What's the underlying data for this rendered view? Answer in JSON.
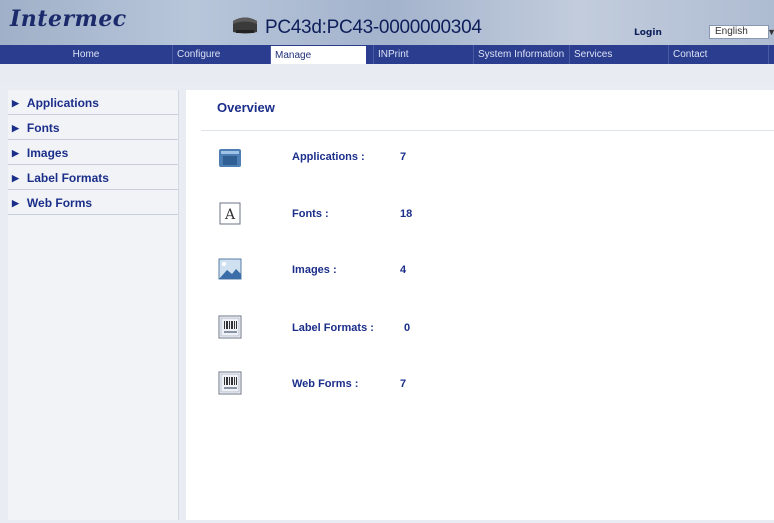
{
  "header": {
    "brand": "Intermec",
    "device_title": "PC43d:PC43-0000000304",
    "login_label": "Login",
    "language": {
      "selected": "English"
    }
  },
  "nav": {
    "items": [
      {
        "label": "Home"
      },
      {
        "label": "Configure"
      },
      {
        "label": "Manage",
        "active": true
      },
      {
        "label": "INPrint"
      },
      {
        "label": "System Information"
      },
      {
        "label": "Services"
      },
      {
        "label": "Contact"
      }
    ]
  },
  "sidebar": {
    "items": [
      {
        "label": "Applications"
      },
      {
        "label": "Fonts"
      },
      {
        "label": "Images"
      },
      {
        "label": "Label Formats"
      },
      {
        "label": "Web Forms"
      }
    ]
  },
  "overview": {
    "title": "Overview",
    "rows": [
      {
        "label": "Applications :",
        "value": "7",
        "icon": "application-icon"
      },
      {
        "label": "Fonts :",
        "value": "18",
        "icon": "font-icon"
      },
      {
        "label": "Images :",
        "value": "4",
        "icon": "image-icon"
      },
      {
        "label": "Label Formats :",
        "value": "0",
        "icon": "label-format-icon"
      },
      {
        "label": "Web Forms :",
        "value": "7",
        "icon": "web-form-icon"
      }
    ]
  },
  "colors": {
    "nav_bg": "#2b3d8f",
    "accent_text": "#1b2e8a",
    "header_bg": "#b0bed4"
  }
}
